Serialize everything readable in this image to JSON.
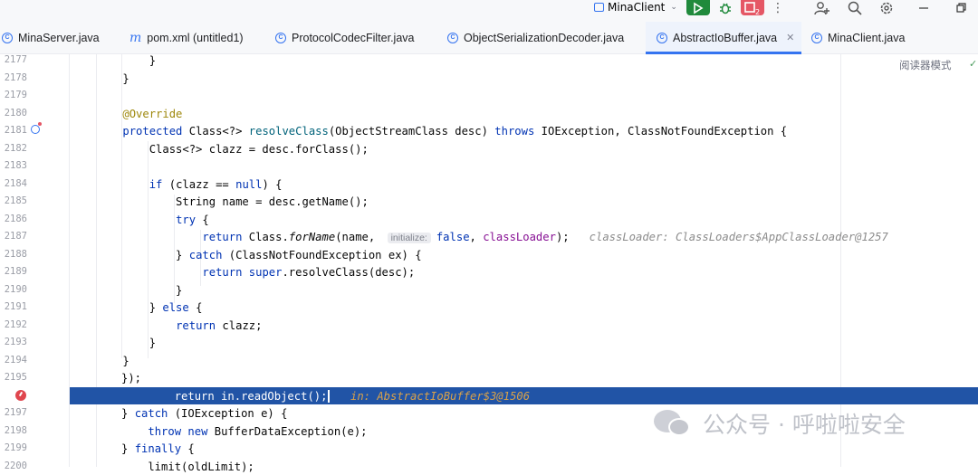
{
  "toolbar": {
    "run_config": "MinaClient",
    "stop_badge": "2"
  },
  "tabs": [
    {
      "label": "MinaServer.java",
      "icon": "class-icon"
    },
    {
      "label": "pom.xml (untitled1)",
      "icon": "maven-icon"
    },
    {
      "label": "ProtocolCodecFilter.java",
      "icon": "class-icon"
    },
    {
      "label": "ObjectSerializationDecoder.java",
      "icon": "class-icon"
    },
    {
      "label": "AbstractIoBuffer.java",
      "icon": "class-icon",
      "active": true
    },
    {
      "label": "MinaClient.java",
      "icon": "class-icon"
    }
  ],
  "editor": {
    "reader_mode": "阅读器模式",
    "lines": [
      {
        "n": "2177",
        "t1": "        }"
      },
      {
        "n": "2178",
        "t1": "    }"
      },
      {
        "n": "2179"
      },
      {
        "n": "2180",
        "t1": "    ",
        "ann": "@Override"
      },
      {
        "n": "2181",
        "t1": "    ",
        "kw1": "protected",
        "t2": " Class<?> ",
        "fn1": "resolveClass",
        "t3": "(ObjectStreamClass desc) ",
        "kw2": "throws",
        "t4": " IOException, ClassNotFoundException {"
      },
      {
        "n": "2182",
        "t1": "        Class<?> clazz = desc.forClass();"
      },
      {
        "n": "2183"
      },
      {
        "n": "2184",
        "t1": "        ",
        "kw1": "if",
        "t2": " (clazz == ",
        "kw2": "null",
        "t3": ") {"
      },
      {
        "n": "2185",
        "t1": "            String name = desc.getName();"
      },
      {
        "n": "2186",
        "t1": "            ",
        "kw1": "try",
        "t2": " {"
      },
      {
        "n": "2187",
        "t1": "                ",
        "kw1": "return",
        "t2": " Class.",
        "sm": "forName",
        "t3": "(name, ",
        "hint": "initialize:",
        "kw2": "false",
        "t4": ", ",
        "fld": "classLoader",
        "t5": ");",
        "inline": "classLoader: ClassLoaders$AppClassLoader@1257"
      },
      {
        "n": "2188",
        "t1": "            } ",
        "kw1": "catch",
        "t2": " (ClassNotFoundException ex) {"
      },
      {
        "n": "2189",
        "t1": "                ",
        "kw1": "return",
        "t2": " ",
        "kw2": "super",
        "t3": ".resolveClass(desc);"
      },
      {
        "n": "2190",
        "t1": "            }"
      },
      {
        "n": "2191",
        "t1": "        } ",
        "kw1": "else",
        "t2": " {"
      },
      {
        "n": "2192",
        "t1": "            ",
        "kw1": "return",
        "t2": " clazz;"
      },
      {
        "n": "2193",
        "t1": "        }"
      },
      {
        "n": "2194",
        "t1": "    }"
      },
      {
        "n": "2195",
        "t1": "});"
      },
      {
        "n": "",
        "t1": "        return in.readObject();",
        "inline": "in: AbstractIoBuffer$3@1506"
      },
      {
        "n": "2197",
        "t1": "} ",
        "kw1": "catch",
        "t2": " (IOException e) {"
      },
      {
        "n": "2198",
        "t1": "    ",
        "kw1": "throw",
        "t2": " ",
        "kw2": "new",
        "t3": " BufferDataException(e);"
      },
      {
        "n": "2199",
        "t1": "} ",
        "kw1": "finally",
        "t2": " {"
      },
      {
        "n": "2200",
        "t1": "    limit(oldLimit);"
      }
    ]
  },
  "watermark": "公众号 · 呼啦啦安全"
}
